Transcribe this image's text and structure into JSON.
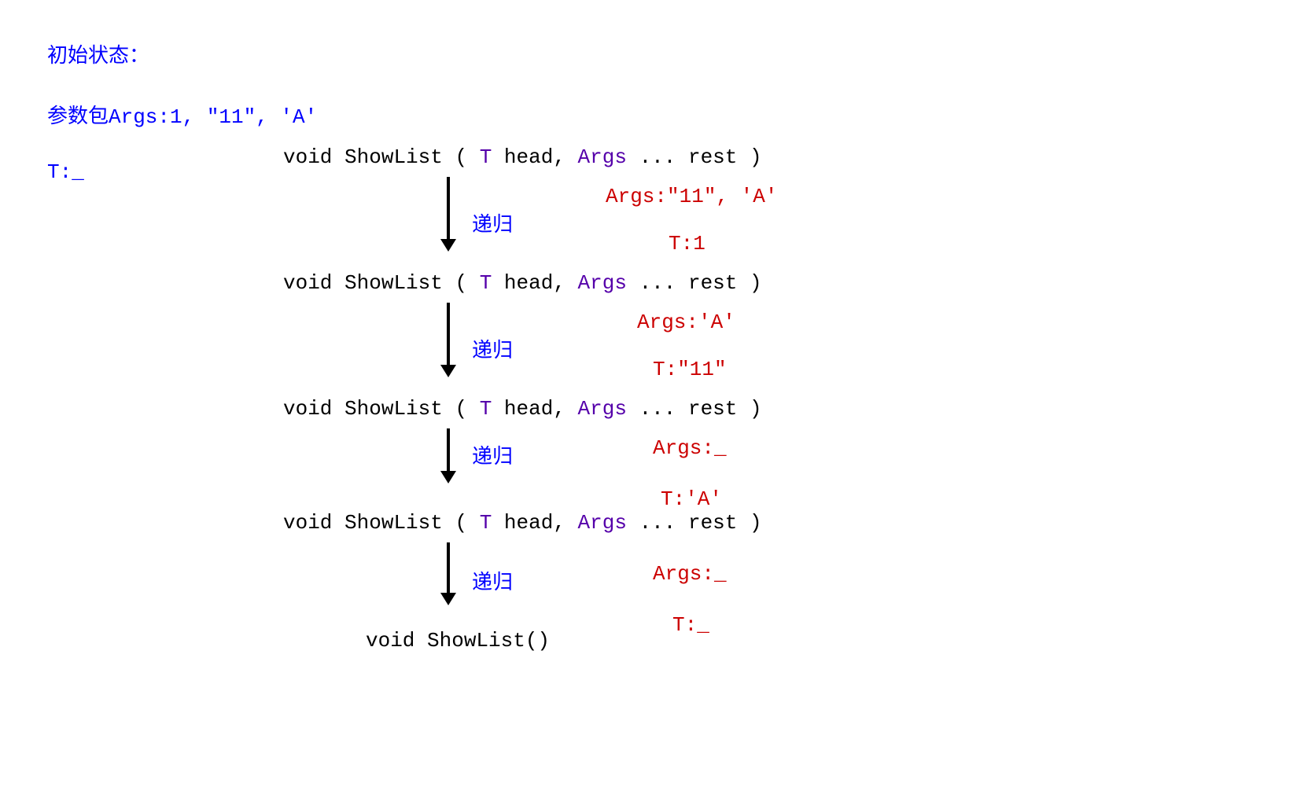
{
  "header": {
    "initial_state": "初始状态：",
    "args_pack": "参数包Args:1, \"11\", 'A'",
    "t_empty": "T:_"
  },
  "signature": {
    "void_keyword": "void",
    "func_name": "ShowList",
    "open_paren": "(",
    "t_param": "T",
    "head_param": " head, ",
    "args_param": "Args",
    "rest_param": "... rest",
    "close_paren": ")"
  },
  "recurse_label": "递归",
  "steps": [
    {
      "args": "Args:\"11\", 'A'",
      "t": "T:1"
    },
    {
      "args": "Args:'A'",
      "t": "T:\"11\""
    },
    {
      "args": "Args:_",
      "t": "T:'A'"
    },
    {
      "args": "Args:_",
      "t": "T:_"
    }
  ],
  "final_signature": "void ShowList()"
}
